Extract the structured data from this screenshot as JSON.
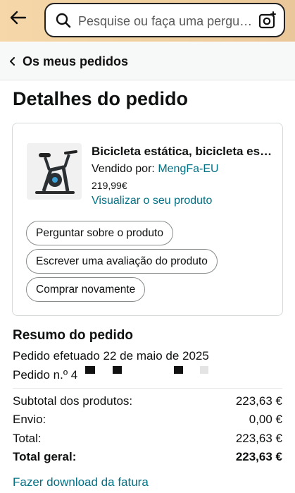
{
  "header": {
    "search_placeholder": "Pesquise ou faça uma pergunta",
    "icons": {
      "back": "back-arrow-icon",
      "search": "search-icon",
      "camera": "camera-lens-icon"
    },
    "colors": {
      "bar": "#f0cfa0"
    }
  },
  "breadcrumb": {
    "label": "Os meus pedidos"
  },
  "page": {
    "title": "Detalhes do pedido"
  },
  "product": {
    "title": "Bicicleta estática, bicicleta estática de spinning",
    "seller_prefix": "Vendido por:",
    "seller_name": "MengFa-EU",
    "price": "219,99€",
    "view_link": "Visualizar o seu produto",
    "actions": [
      "Perguntar sobre o produto",
      "Escrever uma avaliação do produto",
      "Comprar novamente"
    ]
  },
  "summary": {
    "title": "Resumo do pedido",
    "order_date": "Pedido efetuado 22 de maio de 2025",
    "order_number_prefix": "Pedido n.º 4",
    "rows": [
      {
        "label": "Subtotal dos produtos:",
        "value": "223,63 €"
      },
      {
        "label": "Envio:",
        "value": "0,00 €"
      },
      {
        "label": "Total:",
        "value": "223,63 €"
      },
      {
        "label": "Total geral:",
        "value": "223,63 €"
      }
    ],
    "invoice_link": "Fazer download da fatura"
  },
  "colors": {
    "link": "#007185",
    "text": "#0f1111"
  }
}
